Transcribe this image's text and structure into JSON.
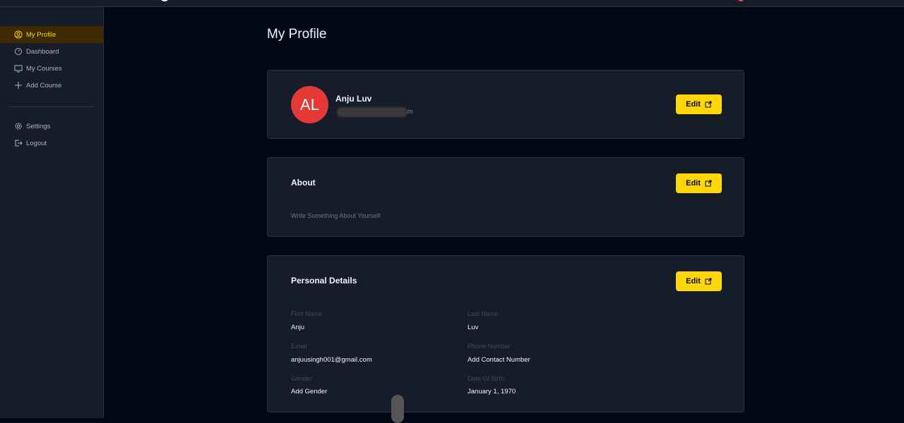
{
  "sidebar": {
    "items": [
      {
        "label": "My Profile",
        "icon": "user-circle-icon",
        "active": true
      },
      {
        "label": "Dashboard",
        "icon": "dashboard-icon",
        "active": false
      },
      {
        "label": "My Courses",
        "icon": "monitor-icon",
        "active": false
      },
      {
        "label": "Add Course",
        "icon": "plus-icon",
        "active": false
      }
    ],
    "bottom_items": [
      {
        "label": "Settings",
        "icon": "gear-icon"
      },
      {
        "label": "Logout",
        "icon": "logout-icon"
      }
    ]
  },
  "page": {
    "title": "My Profile"
  },
  "profile_card": {
    "avatar_initials": "AL",
    "avatar_color": "#e53935",
    "name": "Anju Luv",
    "email_visible_tail": "m",
    "edit_label": "Edit"
  },
  "about_card": {
    "heading": "About",
    "text": "Write Something About Yourself",
    "edit_label": "Edit"
  },
  "personal_card": {
    "heading": "Personal Details",
    "edit_label": "Edit",
    "fields": [
      {
        "label": "First Name",
        "value": "Anju"
      },
      {
        "label": "Last Name",
        "value": "Luv"
      },
      {
        "label": "Email",
        "value": "anjuusingh001@gmail.com"
      },
      {
        "label": "Phone Number",
        "value": "Add Contact Number"
      },
      {
        "label": "Gender",
        "value": "Add Gender"
      },
      {
        "label": "Date Of Birth",
        "value": "January 1, 1970"
      }
    ]
  },
  "colors": {
    "accent": "#ffd60a",
    "background": "#000814",
    "card": "#161d29"
  }
}
